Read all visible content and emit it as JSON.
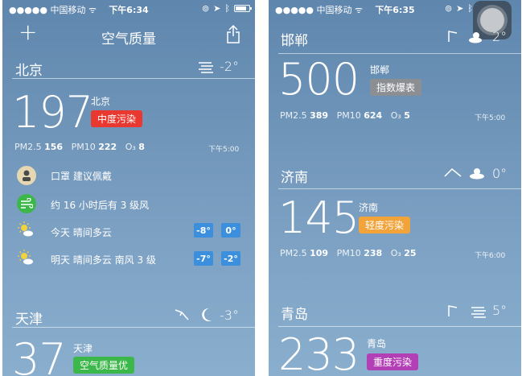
{
  "left": {
    "status": {
      "carrier": "●●●●● 中国移动 ᯤ",
      "time": "下午6:34"
    },
    "title": "空气质量",
    "cities": [
      {
        "name": "北京",
        "temp": "-2°",
        "aqi": "197",
        "city_label": "北京",
        "status": "中度污染",
        "pm25_label": "PM2.5",
        "pm25": "156",
        "pm10_label": "PM10",
        "pm10": "222",
        "o3_label": "O₃",
        "o3": "8",
        "update_time": "下午5:00"
      },
      {
        "name": "天津",
        "temp": "-3°",
        "aqi": "37",
        "city_label": "天津",
        "status": "空气质量优"
      }
    ],
    "advice": [
      {
        "icon": "mask-icon",
        "text": "口罩 建议佩戴"
      },
      {
        "icon": "wind-icon",
        "text": "约 16 小时后有 3 级风"
      }
    ],
    "forecast": [
      {
        "text": "今天 晴间多云",
        "high": "-8°",
        "low": "0°"
      },
      {
        "text": "明天 晴间多云 南风 3 级",
        "high": "-7°",
        "low": "-2°"
      }
    ]
  },
  "right": {
    "status": {
      "carrier": "●●●●● 中国移动 ᯤ",
      "time": "下午6:35"
    },
    "cities": [
      {
        "name": "邯郸",
        "temp": "2°",
        "aqi": "500",
        "city_label": "邯郸",
        "status": "指数爆表",
        "pm25_label": "PM2.5",
        "pm25": "389",
        "pm10_label": "PM10",
        "pm10": "624",
        "o3_label": "O₃",
        "o3": "5",
        "update_time": "下午5:00"
      },
      {
        "name": "济南",
        "temp": "0°",
        "aqi": "145",
        "city_label": "济南",
        "status": "轻度污染",
        "pm25_label": "PM2.5",
        "pm25": "109",
        "pm10_label": "PM10",
        "pm10": "238",
        "o3_label": "O₃",
        "o3": "25",
        "update_time": "下午6:00"
      },
      {
        "name": "青岛",
        "temp": "5°",
        "aqi": "233",
        "city_label": "青岛",
        "status": "重度污染"
      }
    ]
  },
  "colors": {
    "moderate": "#e8382f",
    "excellent": "#3cb84a",
    "beyond": "#8b8f93",
    "light": "#f2a33a",
    "heavy": "#b23fb5",
    "temp_box": "#3b8fdc"
  }
}
